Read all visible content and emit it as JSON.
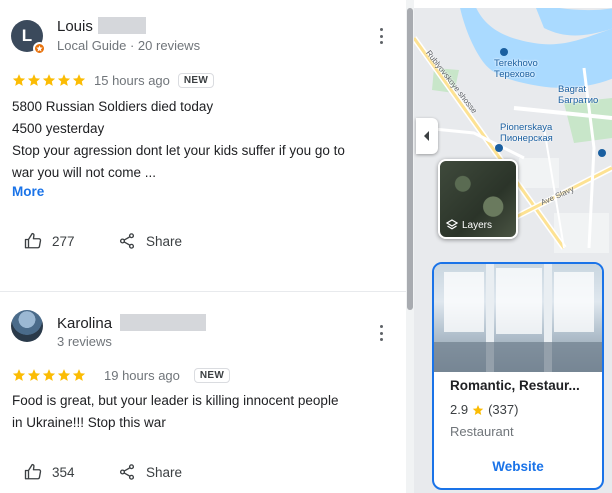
{
  "reviews": [
    {
      "avatar_letter": "L",
      "name": "Louis",
      "meta": "Local Guide · 20 reviews",
      "rating": 5,
      "time": "15 hours ago",
      "badge": "NEW",
      "text_lines": [
        "5800 Russian Soldiers died today",
        "4500 yesterday",
        "Stop your agression dont let your kids suffer if you go to",
        "war you will not come ..."
      ],
      "more_label": "More",
      "likes": "277",
      "share_label": "Share"
    },
    {
      "name": "Karolina",
      "meta": "3 reviews",
      "rating": 5,
      "time": "19 hours ago",
      "badge": "NEW",
      "text_lines": [
        "Food is great, but your leader is killing innocent people",
        "in Ukraine!!! Stop this war"
      ],
      "likes": "354",
      "share_label": "Share"
    }
  ],
  "map": {
    "labels": {
      "terekhovo_en": "Terekhovo",
      "terekhovo_ru": "Терехово",
      "bagrat_en": "Bagrat",
      "bagrat_ru": "Багратио",
      "pionerskaya_en": "Pionerskaya",
      "pionerskaya_ru": "Пионерская",
      "road_1": "Rublyovskoye shosse",
      "road_2": "Ave Slavy"
    },
    "layers_label": "Layers"
  },
  "place": {
    "name": "Romantic, Restaur...",
    "rating": "2.9",
    "reviews_count": "(337)",
    "type": "Restaurant",
    "website_label": "Website"
  },
  "colors": {
    "star": "#fbbc04",
    "link": "#1a73e8",
    "guide_badge": "#e8710a"
  }
}
